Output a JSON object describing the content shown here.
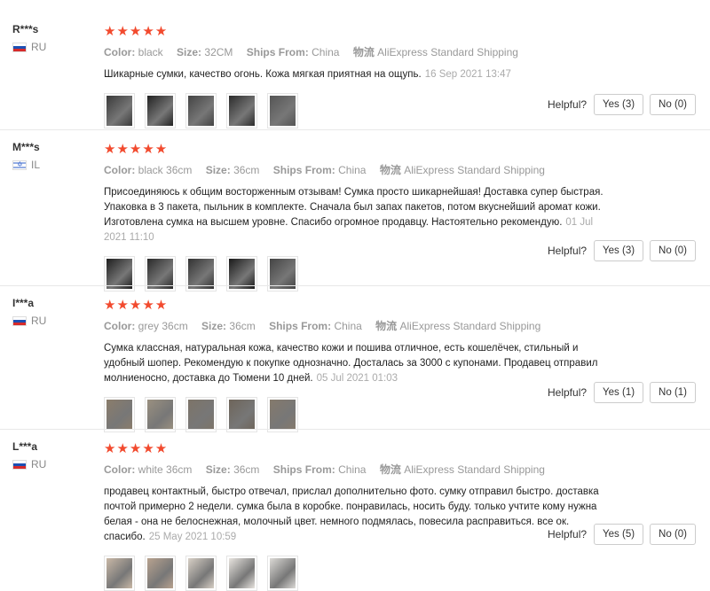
{
  "labels": {
    "color": "Color:",
    "size": "Size:",
    "ships_from": "Ships From:",
    "shipping_prefix": "物流",
    "helpful": "Helpful?"
  },
  "stars": "★★★★★",
  "colors": {
    "star": "#f24a2e",
    "border": "#e8e8e8"
  },
  "reviews": [
    {
      "user": "R***s",
      "country": "RU",
      "flag": "ru",
      "color": "black",
      "size": "32CM",
      "ships_from": "China",
      "shipping": "AliExpress Standard Shipping",
      "text": "Шикарные сумки, качество огонь. Кожа мягкая приятная на ощупь.",
      "date": "16 Sep 2021 13:47",
      "yes": "Yes (3)",
      "no": "No (0)"
    },
    {
      "user": "M***s",
      "country": "IL",
      "flag": "il",
      "color": "black 36cm",
      "size": "36cm",
      "ships_from": "China",
      "shipping": "AliExpress Standard Shipping",
      "text": "Присоединяюсь к общим восторженным отзывам! Сумка просто шикарнейшая! Доставка супер быстрая. Упаковка в 3 пакета, пыльник в комплекте. Сначала был запах пакетов, потом вкуснейший аромат кожи. Изготовлена сумка на высшем уровне. Спасибо огромное продавцу. Настоятельно рекомендую.",
      "date": "01 Jul 2021 11:10",
      "yes": "Yes (3)",
      "no": "No (0)"
    },
    {
      "user": "I***a",
      "country": "RU",
      "flag": "ru",
      "color": "grey 36cm",
      "size": "36cm",
      "ships_from": "China",
      "shipping": "AliExpress Standard Shipping",
      "text": "Сумка классная, натуральная кожа, качество кожи и пошива отличное, есть кошелёчек, стильный и удобный шопер. Рекомендую к покупке однозначно. Досталась за 3000 с купонами. Продавец отправил молниеносно, доставка до Тюмени 10 дней.",
      "date": "05 Jul 2021 01:03",
      "yes": "Yes (1)",
      "no": "No (1)"
    },
    {
      "user": "L***a",
      "country": "RU",
      "flag": "ru",
      "color": "white 36cm",
      "size": "36cm",
      "ships_from": "China",
      "shipping": "AliExpress Standard Shipping",
      "text": "продавец контактный, быстро отвечал, прислал дополнительно фото. сумку отправил быстро. доставка почтой примерно 2 недели. сумка была в коробке. понравилась, носить буду. только учтите кому нужна белая - она не белоснежная, молочный цвет. немного подмялась, повесила расправиться. все ок. спасибо.",
      "date": "25 May 2021 10:59",
      "yes": "Yes (5)",
      "no": "No (0)"
    }
  ]
}
